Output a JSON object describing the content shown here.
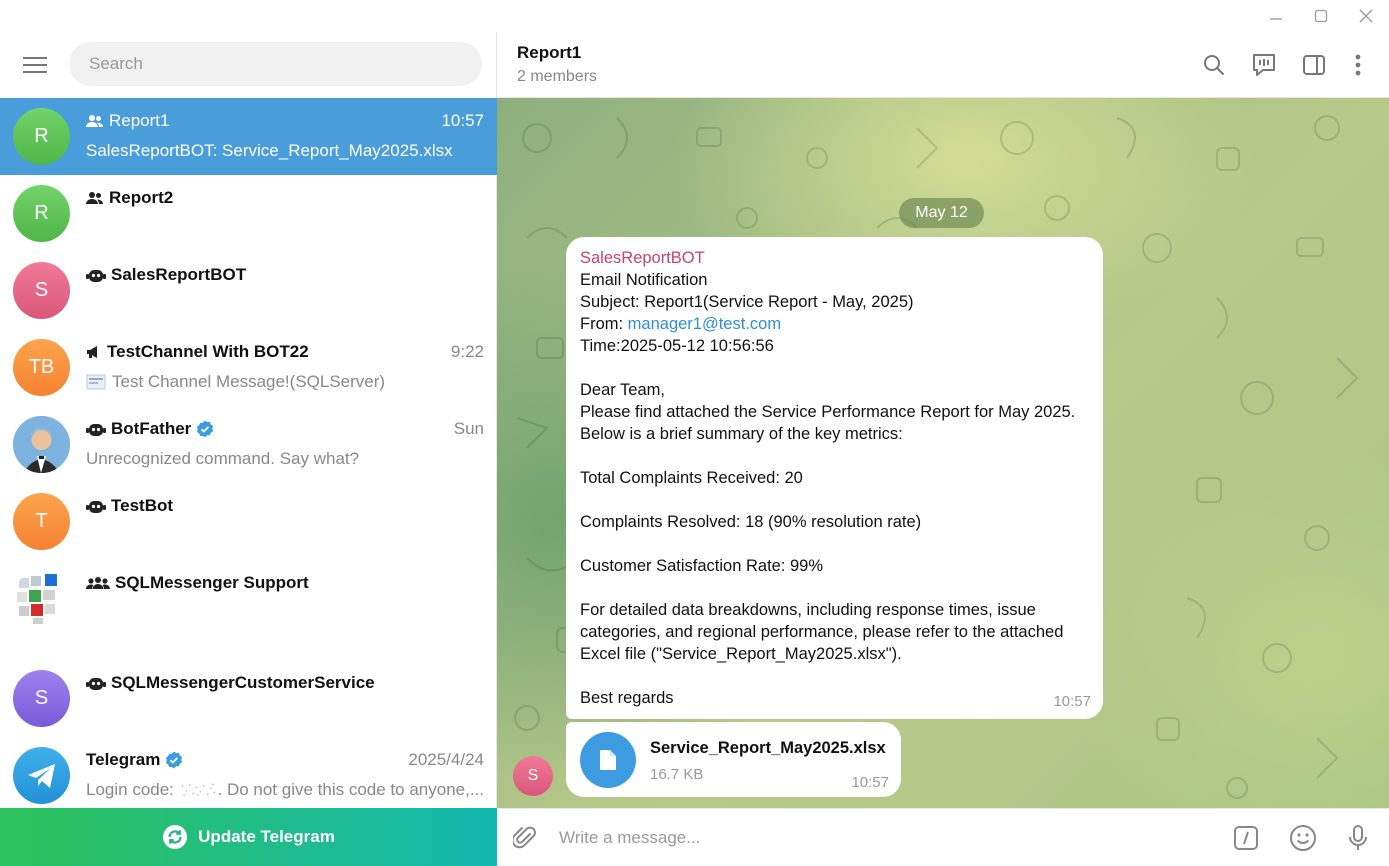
{
  "window": {
    "controls": [
      "minimize-icon",
      "maximize-icon",
      "close-icon"
    ]
  },
  "search": {
    "placeholder": "Search"
  },
  "chats": [
    {
      "name": "Report1",
      "type": "group",
      "time": "10:57",
      "preview": "SalesReportBOT: Service_Report_May2025.xlsx",
      "avatar": "R",
      "avatar_color": "#5cc456",
      "active": true
    },
    {
      "name": "Report2",
      "type": "group",
      "time": "",
      "preview": "",
      "avatar": "R",
      "avatar_color": "#5cc456"
    },
    {
      "name": "SalesReportBOT",
      "type": "bot",
      "time": "",
      "preview": "",
      "avatar": "S",
      "avatar_color": "#e0628a"
    },
    {
      "name": "TestChannel With BOT22",
      "type": "channel",
      "time": "9:22",
      "preview": "Test Channel Message!(SQLServer)",
      "avatar": "TB",
      "avatar_color": "#f98d3a"
    },
    {
      "name": "BotFather",
      "type": "bot",
      "verified": true,
      "time": "Sun",
      "preview": "Unrecognized command. Say what?",
      "avatar": "",
      "avatar_color": "#7fb3df"
    },
    {
      "name": "TestBot",
      "type": "bot",
      "time": "",
      "preview": "",
      "avatar": "T",
      "avatar_color": "#f98d3a"
    },
    {
      "name": "SQLMessenger Support",
      "type": "supergroup",
      "time": "",
      "preview": "",
      "avatar": "",
      "avatar_color": "#ffffff"
    },
    {
      "name": "SQLMessengerCustomerService",
      "type": "bot",
      "time": "",
      "preview": "",
      "avatar": "S",
      "avatar_color": "#8a6ce0"
    },
    {
      "name": "Telegram",
      "type": "user",
      "verified": true,
      "time": "2025/4/24",
      "preview_prefix": "Login code:",
      "preview": ". Do not give this code to anyone,...",
      "avatar": "",
      "avatar_color": "#2ba0df"
    }
  ],
  "update_bar": {
    "label": "Update Telegram"
  },
  "chat_header": {
    "title": "Report1",
    "subtitle": "2 members"
  },
  "date_pill": "May 12",
  "message": {
    "sender": "SalesReportBOT",
    "lines": [
      "Email Notification",
      "Subject: Report1(Service Report - May, 2025)",
      "From: ",
      "Time:2025-05-12 10:56:56",
      "",
      "Dear Team,",
      "Please find attached the Service Performance Report for May 2025.",
      "Below is a brief summary of the key metrics:",
      "",
      "Total Complaints Received: 20",
      "",
      "Complaints Resolved: 18 (90% resolution rate)",
      "",
      "Customer Satisfaction Rate: 99%",
      "",
      "For detailed data breakdowns, including response times, issue",
      "categories, and regional performance, please refer to the attached",
      "Excel file (\"Service_Report_May2025.xlsx\").",
      "",
      "Best regards"
    ],
    "from_email": "manager1@test.com",
    "time": "10:57"
  },
  "file": {
    "name": "Service_Report_May2025.xlsx",
    "size": "16.7 KB",
    "time": "10:57",
    "sender_avatar": "S"
  },
  "composer": {
    "placeholder": "Write a message..."
  }
}
